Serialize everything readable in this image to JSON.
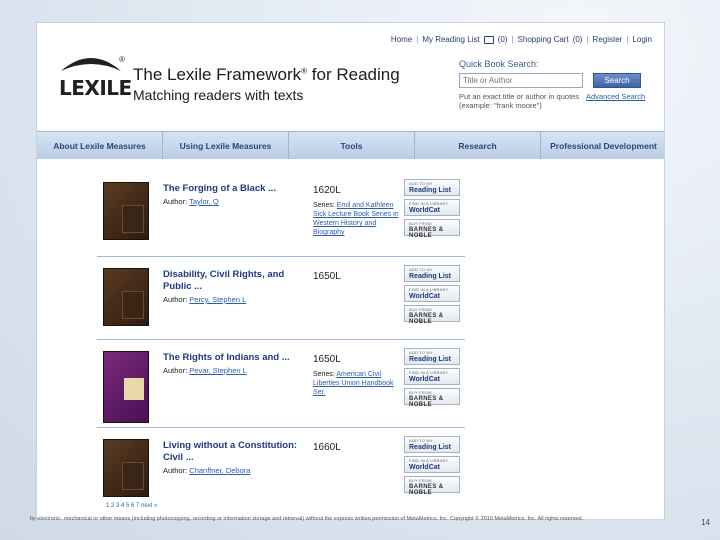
{
  "topnav": {
    "home": "Home",
    "my_reading_list": "My Reading List",
    "reading_count": "(0)",
    "shopping_cart": "Shopping Cart",
    "cart_count": "(0)",
    "register": "Register",
    "login": "Login"
  },
  "brand": {
    "logo_text": "LEXILE",
    "logo_reg": "®",
    "title": "The Lexile Framework",
    "title_reg": "®",
    "title_suffix": " for Reading",
    "tagline": "Matching readers with texts"
  },
  "quick_search": {
    "label": "Quick Book Search:",
    "placeholder": "Title or Author",
    "button": "Search",
    "hint": "Put an exact title or author in quotes (example: \"frank moore\")",
    "advanced": "Advanced Search"
  },
  "main_nav": [
    {
      "label": "About Lexile Measures"
    },
    {
      "label": "Using Lexile Measures"
    },
    {
      "label": "Tools"
    },
    {
      "label": "Research"
    },
    {
      "label": "Professional Development"
    }
  ],
  "books": [
    {
      "title": "The Forging of a Black ...",
      "author_label": "Author:",
      "author": "Taylor, Q",
      "lexile": "1620L",
      "series_label": "Series:",
      "series": "Emil and Kathleen Sick Lecture Book Series in Western History and Biography"
    },
    {
      "title": "Disability, Civil Rights, and Public ...",
      "author_label": "Author:",
      "author": "Percy, Stephen L",
      "lexile": "1650L",
      "series_label": "",
      "series": ""
    },
    {
      "title": "The Rights of Indians and ...",
      "author_label": "Author:",
      "author": "Pevar, Stephen L",
      "lexile": "1650L",
      "series_label": "Series:",
      "series": "American Civil Liberties Union Handbook Ser."
    },
    {
      "title": "Living without a Constitution: Civil ...",
      "author_label": "Author:",
      "author": "Chanffner, Debora",
      "lexile": "1660L",
      "series_label": "",
      "series": ""
    }
  ],
  "actions": {
    "add_small": "ADD TO MY",
    "add_big": "Reading List",
    "library_small": "FIND IN A LIBRARY",
    "library_big": "WorldCat",
    "buy_small": "BUY FROM",
    "buy_big": "BARNES & NOBLE"
  },
  "pagination": "1 2 3 4 5 6 7 next »",
  "footer": "by electronic, mechanical or other means (including photocopying, recording or information storage and retrieval) without the express written permission of MetaMetrics, Inc. Copyright © 2010 MetaMetrics, Inc. All rights reserved.",
  "page_number": "14"
}
